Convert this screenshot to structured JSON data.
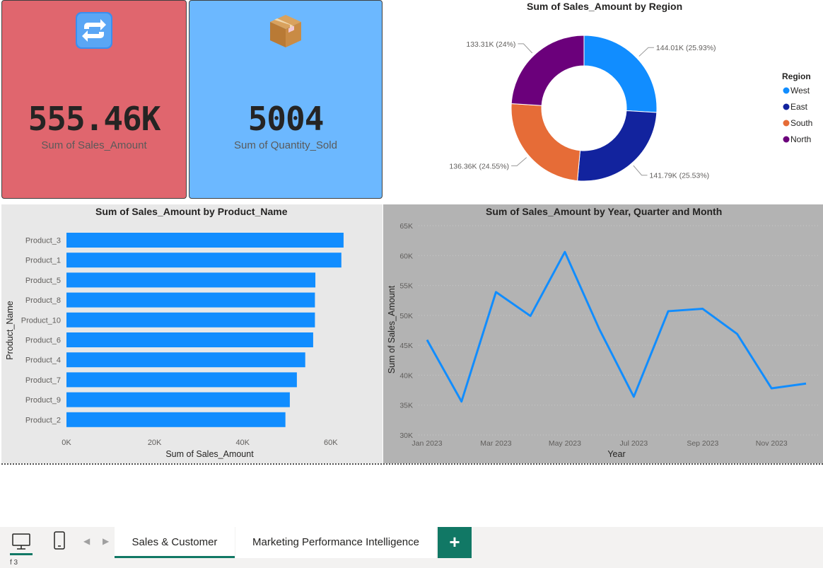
{
  "kpi_cards": [
    {
      "value": "555.46K",
      "label": "Sum of Sales_Amount",
      "icon": "repeat-arrows-icon",
      "color": "#e0666e"
    },
    {
      "value": "5004",
      "label": "Sum of Quantity_Sold",
      "icon": "package-box-icon",
      "color": "#6cb8ff"
    }
  ],
  "donut": {
    "title": "Sum of Sales_Amount by Region",
    "legend_title": "Region",
    "legend": [
      "West",
      "East",
      "South",
      "North"
    ]
  },
  "bar": {
    "title": "Sum of Sales_Amount by Product_Name"
  },
  "line": {
    "title": "Sum of Sales_Amount by Year, Quarter and Month"
  },
  "chart_data": [
    {
      "type": "pie",
      "title": "Sum of Sales_Amount by Region",
      "legend_title": "Region",
      "legend_position": "right",
      "slices": [
        {
          "name": "West",
          "value": 144.01,
          "label": "144.01K (25.93%)",
          "color": "#118dff"
        },
        {
          "name": "East",
          "value": 141.79,
          "label": "141.79K (25.53%)",
          "color": "#12239e"
        },
        {
          "name": "South",
          "value": 136.36,
          "label": "136.36K (24.55%)",
          "color": "#e66c37"
        },
        {
          "name": "North",
          "value": 133.31,
          "label": "133.31K (24%)",
          "color": "#6b007b"
        }
      ]
    },
    {
      "type": "bar",
      "orientation": "horizontal",
      "title": "Sum of Sales_Amount by Product_Name",
      "xlabel": "Sum of Sales_Amount",
      "ylabel": "Product_Name",
      "categories": [
        "Product_3",
        "Product_1",
        "Product_5",
        "Product_8",
        "Product_10",
        "Product_6",
        "Product_4",
        "Product_7",
        "Product_9",
        "Product_2"
      ],
      "values": [
        62900,
        62400,
        56500,
        56400,
        56400,
        56000,
        54200,
        52300,
        50700,
        49700
      ],
      "xlim": [
        0,
        65000
      ],
      "xticks": [
        "0K",
        "20K",
        "40K",
        "60K"
      ],
      "xtick_values": [
        0,
        20000,
        40000,
        60000
      ],
      "color": "#118dff"
    },
    {
      "type": "line",
      "title": "Sum of Sales_Amount by Year, Quarter and Month",
      "xlabel": "Year",
      "ylabel": "Sum of Sales_Amount",
      "x": [
        "Jan 2023",
        "Feb 2023",
        "Mar 2023",
        "Apr 2023",
        "May 2023",
        "Jun 2023",
        "Jul 2023",
        "Aug 2023",
        "Sep 2023",
        "Oct 2023",
        "Nov 2023",
        "Dec 2023"
      ],
      "xticks": [
        "Jan 2023",
        "Mar 2023",
        "May 2023",
        "Jul 2023",
        "Sep 2023",
        "Nov 2023"
      ],
      "values": [
        45900,
        35600,
        53900,
        49900,
        60600,
        47700,
        36400,
        50700,
        51100,
        46900,
        37800,
        38600
      ],
      "ylim": [
        30000,
        65000
      ],
      "yticks": [
        "30K",
        "35K",
        "40K",
        "45K",
        "50K",
        "55K",
        "60K",
        "65K"
      ],
      "ytick_values": [
        30000,
        35000,
        40000,
        45000,
        50000,
        55000,
        60000,
        65000
      ],
      "grid": true,
      "color": "#118dff"
    }
  ],
  "tabs": {
    "active": "Sales & Customer",
    "other": "Marketing Performance Intelligence",
    "add": "+"
  },
  "status": {
    "text": "f 3"
  }
}
